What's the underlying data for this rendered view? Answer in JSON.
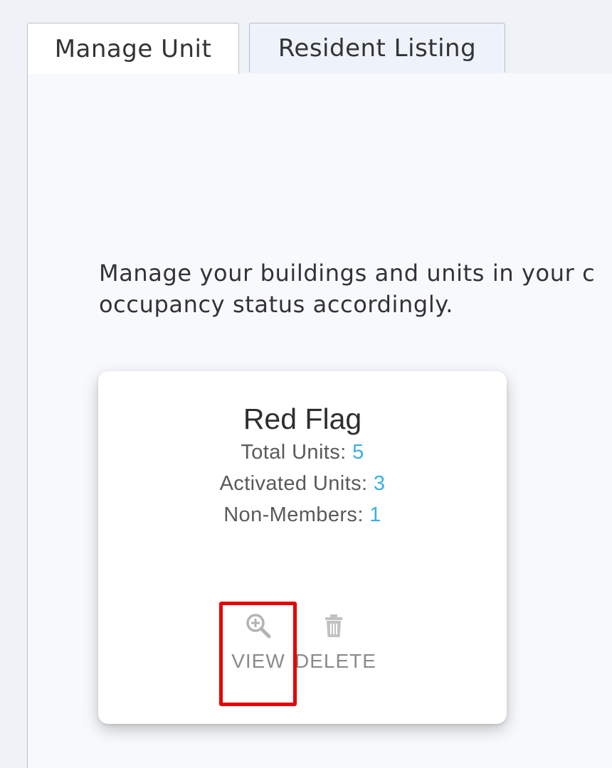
{
  "tabs": [
    {
      "label": "Manage Unit",
      "active": true
    },
    {
      "label": "Resident Listing",
      "active": false
    }
  ],
  "main": {
    "description_lines": [
      "Manage your buildings and units in your c",
      "occupancy status accordingly."
    ]
  },
  "card": {
    "title": "Red Flag",
    "stats": [
      {
        "label": "Total Units:",
        "value": "5"
      },
      {
        "label": "Activated Units:",
        "value": "3"
      },
      {
        "label": "Non-Members:",
        "value": "1"
      }
    ],
    "actions": {
      "view_label": "VIEW",
      "delete_label": "DELETE"
    }
  },
  "colors": {
    "accent_number": "#3ab0e2",
    "highlight_box": "#e60000",
    "icon_gray": "#b3b3b3"
  },
  "icons": {
    "view": "zoom-in-icon",
    "delete": "trash-icon"
  }
}
